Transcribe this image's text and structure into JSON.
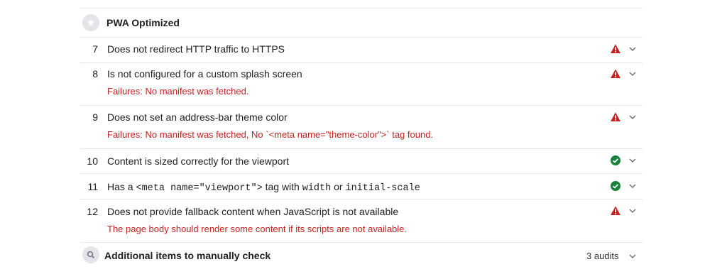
{
  "group": {
    "title": "PWA Optimized"
  },
  "audits": [
    {
      "number": "7",
      "title": "Does not redirect HTTP traffic to HTTPS",
      "status": "fail",
      "failure": ""
    },
    {
      "number": "8",
      "title": "Is not configured for a custom splash screen",
      "status": "fail",
      "failure": "Failures: No manifest was fetched."
    },
    {
      "number": "9",
      "title": "Does not set an address-bar theme color",
      "status": "fail",
      "failure": "Failures: No manifest was fetched, No `<meta name=\"theme-color\">` tag found."
    },
    {
      "number": "10",
      "title": "Content is sized correctly for the viewport",
      "status": "pass",
      "failure": ""
    },
    {
      "number": "11",
      "title_parts": [
        "Has a ",
        "<meta name=\"viewport\">",
        " tag with ",
        "width",
        " or ",
        "initial-scale"
      ],
      "status": "pass",
      "failure": ""
    },
    {
      "number": "12",
      "title": "Does not provide fallback content when JavaScript is not available",
      "status": "fail",
      "failure": "The page body should render some content if its scripts are not available."
    }
  ],
  "manual_check": {
    "title": "Additional items to manually check",
    "count_label": "3 audits"
  },
  "colors": {
    "fail": "#c7221f",
    "pass": "#178239",
    "failure_text": "#c7221f"
  },
  "icons": {
    "group_badge": "star-icon",
    "fail": "warning-triangle-icon",
    "pass": "check-circle-icon",
    "expand": "chevron-down-icon",
    "manual_badge": "search-icon"
  }
}
